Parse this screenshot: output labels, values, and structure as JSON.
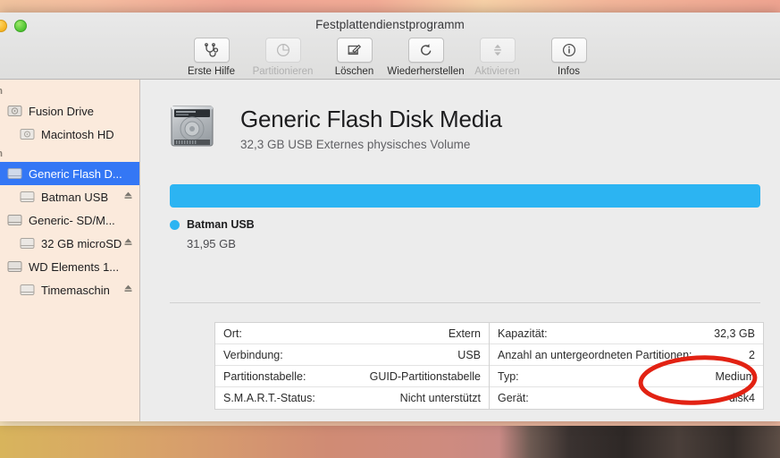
{
  "window": {
    "title": "Festplattendienstprogramm",
    "traffic_lights": [
      "yellow",
      "green"
    ]
  },
  "toolbar": {
    "buttons": [
      {
        "label": "Erste Hilfe",
        "icon": "stethoscope-icon",
        "enabled": true
      },
      {
        "label": "Partitionieren",
        "icon": "pie-chart-icon",
        "enabled": false
      },
      {
        "label": "Löschen",
        "icon": "erase-icon",
        "enabled": true
      },
      {
        "label": "Wiederherstellen",
        "icon": "restore-icon",
        "enabled": true
      },
      {
        "label": "Aktivieren",
        "icon": "mount-icon",
        "enabled": false
      },
      {
        "label": "Infos",
        "icon": "info-icon",
        "enabled": true
      }
    ]
  },
  "sidebar": {
    "sections": [
      {
        "header": "rn",
        "items": [
          {
            "label": "Fusion Drive",
            "indent": false,
            "selected": false,
            "eject": false
          },
          {
            "label": "Macintosh HD",
            "indent": true,
            "selected": false,
            "eject": false
          }
        ]
      },
      {
        "header": "rn",
        "items": [
          {
            "label": "Generic Flash D...",
            "indent": false,
            "selected": true,
            "eject": false
          },
          {
            "label": "Batman USB",
            "indent": true,
            "selected": false,
            "eject": true
          },
          {
            "label": "Generic- SD/M...",
            "indent": false,
            "selected": false,
            "eject": false
          },
          {
            "label": "32 GB microSD",
            "indent": true,
            "selected": false,
            "eject": true
          },
          {
            "label": "WD Elements 1...",
            "indent": false,
            "selected": false,
            "eject": false
          },
          {
            "label": "Timemaschin",
            "indent": true,
            "selected": false,
            "eject": true
          }
        ]
      }
    ]
  },
  "main": {
    "disk_icon": "hard-disk-icon",
    "title": "Generic Flash Disk Media",
    "subtitle": "32,3 GB USB Externes physisches Volume",
    "capacity_bar": {
      "segments": [
        {
          "name": "Batman USB",
          "size": "31,95 GB",
          "color": "#2cb4f2",
          "percent": 100
        }
      ]
    },
    "info_table": {
      "left": [
        {
          "key": "Ort:",
          "value": "Extern"
        },
        {
          "key": "Verbindung:",
          "value": "USB"
        },
        {
          "key": "Partitionstabelle:",
          "value": "GUID-Partitionstabelle"
        },
        {
          "key": "S.M.A.R.T.-Status:",
          "value": "Nicht unterstützt"
        }
      ],
      "right": [
        {
          "key": "Kapazität:",
          "value": "32,3 GB"
        },
        {
          "key": "Anzahl an untergeordneten Partitionen:",
          "value": "2"
        },
        {
          "key": "Typ:",
          "value": "Medium"
        },
        {
          "key": "Gerät:",
          "value": "disk4"
        }
      ]
    }
  },
  "annotation": {
    "shape": "red-ellipse",
    "color": "#e22213",
    "targets": "disk4"
  },
  "colors": {
    "accent_blue": "#2cb4f2",
    "selection_blue": "#3477f5",
    "annotation_red": "#e22213",
    "sidebar_bg": "#fbeadc",
    "content_bg": "#ececec"
  }
}
